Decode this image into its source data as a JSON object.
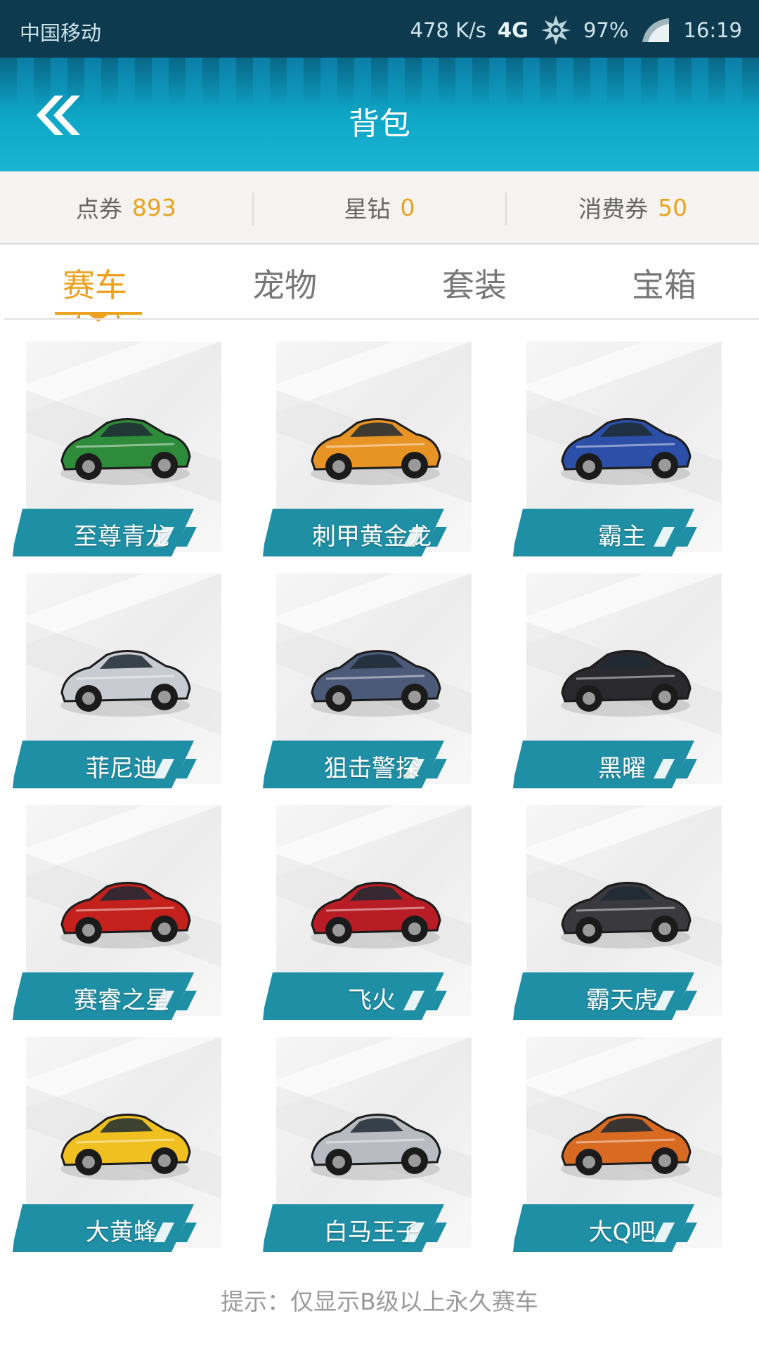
{
  "status_bar": {
    "carrier": "中国移动",
    "speed": "478 K/s",
    "network": "4G",
    "battery": "97%",
    "time": "16:19"
  },
  "header": {
    "title": "背包",
    "back_icon": "double-chevron-left-icon"
  },
  "currency": {
    "items": [
      {
        "label": "点券",
        "value": "893"
      },
      {
        "label": "星钻",
        "value": "0"
      },
      {
        "label": "消费券",
        "value": "50"
      }
    ]
  },
  "tabs": [
    {
      "label": "赛车",
      "active": true
    },
    {
      "label": "宠物",
      "active": false
    },
    {
      "label": "套装",
      "active": false
    },
    {
      "label": "宝箱",
      "active": false
    }
  ],
  "cars": [
    {
      "name": "至尊青龙",
      "color": "#2e8b3a"
    },
    {
      "name": "刺甲黄金龙",
      "color": "#e89424"
    },
    {
      "name": "霸主",
      "color": "#2c4fa8"
    },
    {
      "name": "菲尼迪",
      "color": "#c8ccd2"
    },
    {
      "name": "狙击警探",
      "color": "#4a5a78"
    },
    {
      "name": "黑曜",
      "color": "#2a2a2e"
    },
    {
      "name": "赛睿之星",
      "color": "#c4201c"
    },
    {
      "name": "飞火",
      "color": "#b81c24"
    },
    {
      "name": "霸天虎",
      "color": "#3a3a3e"
    },
    {
      "name": "大黄蜂",
      "color": "#f0c020"
    },
    {
      "name": "白马王子",
      "color": "#b8bcc2"
    },
    {
      "name": "大Q吧",
      "color": "#d86a22"
    }
  ],
  "hint": "提示：仅显示B级以上永久赛车",
  "colors": {
    "header": "#0fa8c8",
    "label_teal": "#1f8fa6",
    "accent_orange": "#eda21f"
  }
}
